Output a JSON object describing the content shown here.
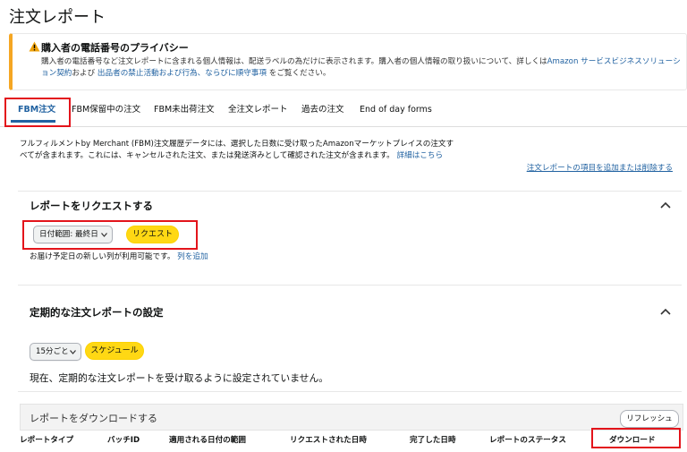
{
  "page": {
    "title": "注文レポート"
  },
  "alert": {
    "title": "購入者の電話番号のプライバシー",
    "text1": "購入者の電話番号など注文レポートに含まれる個人情報は、配送ラベルの為だけに表示されます。購入者の個人情報の取り扱いについて、詳しくは",
    "link1": "Amazon サービスビジネスソリューション契約",
    "text2": "および",
    "link2": "出品者の禁止活動および行為、ならびに順守事項",
    "text3": "をご覧ください。",
    "accent_color": "#f5a623"
  },
  "tabs": [
    {
      "label": "FBM注文",
      "active": true
    },
    {
      "label": "FBM保留中の注文",
      "active": false
    },
    {
      "label": "FBM未出荷注文",
      "active": false
    },
    {
      "label": "全注文レポート",
      "active": false
    },
    {
      "label": "過去の注文",
      "active": false
    },
    {
      "label": "End of day forms",
      "active": false
    }
  ],
  "description": {
    "text": "フルフィルメントby Merchant (FBM)注文履歴データには、選択した日数に受け取ったAmazonマーケットプレイスの注文すべてが含まれます。これには、キャンセルされた注文、または発送済みとして確認された注文が含まれます。",
    "link": "詳細はこちら"
  },
  "add_columns_link": "注文レポートの項目を追加または削除する",
  "request_section": {
    "title": "レポートをリクエストする",
    "date_range_select": "日付範囲: 最終日",
    "request_button": "リクエスト",
    "note_text": "お届け予定日の新しい列が利用可能です。",
    "note_link": "列を追加"
  },
  "schedule_section": {
    "title": "定期的な注文レポートの設定",
    "interval_select": "15分ごと",
    "schedule_button": "スケジュール",
    "status_text": "現在、定期的な注文レポートを受け取るように設定されていません。"
  },
  "download_section": {
    "title": "レポートをダウンロードする",
    "refresh_button": "リフレッシュ",
    "columns": [
      "レポートタイプ",
      "バッチID",
      "適用される日付の範囲",
      "リクエストされた日時",
      "完了した日時",
      "レポートのステータス",
      "ダウンロード"
    ]
  },
  "colors": {
    "link": "#2162a1",
    "button_yellow": "#ffd814",
    "highlight_red": "#e3141b"
  }
}
